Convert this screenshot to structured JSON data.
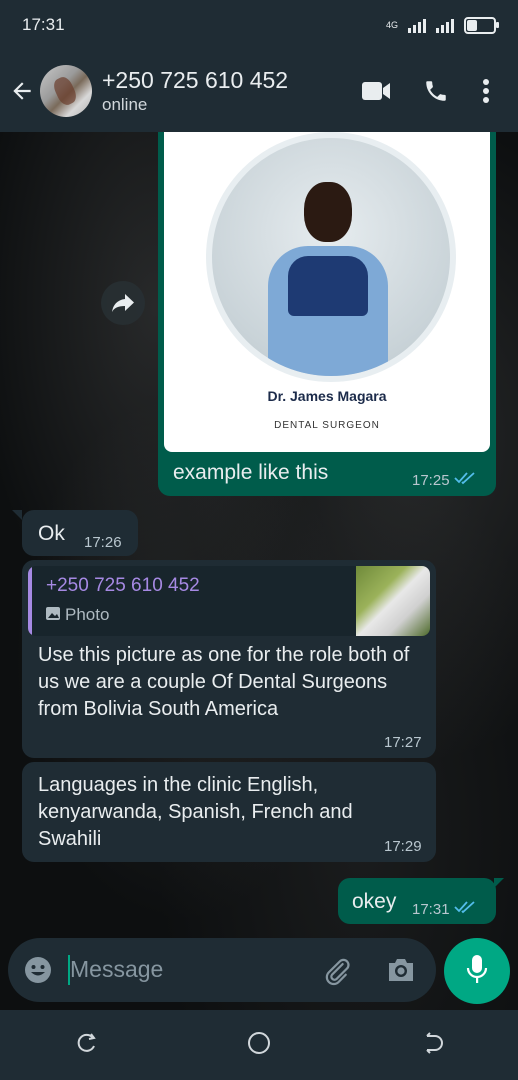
{
  "status_bar": {
    "time": "17:31",
    "network": "4G",
    "battery_level": 0.35
  },
  "header": {
    "contact_name": "+250 725 610 452",
    "contact_status": "online"
  },
  "messages": {
    "image_msg": {
      "card_name": "Dr. James Magara",
      "card_title": "DENTAL SURGEON",
      "caption": "example like this",
      "time": "17:25"
    },
    "ok_msg": {
      "text": "Ok",
      "time": "17:26"
    },
    "reply_msg": {
      "quote_sender": "+250 725 610 452",
      "quote_type": "Photo",
      "text": "Use this picture as one for the role both of us we are a couple Of Dental Surgeons from Bolivia South America",
      "time": "17:27"
    },
    "languages_msg": {
      "text": "Languages in the clinic English, kenyarwanda, Spanish, French and Swahili",
      "time": "17:29"
    },
    "okey_msg": {
      "text": "okey",
      "time": "17:31"
    }
  },
  "composer": {
    "placeholder": "Message"
  },
  "colors": {
    "accent": "#00a884",
    "outgoing_bubble": "#005c4b",
    "incoming_bubble": "#1f2c34",
    "read_ticks": "#53bdeb",
    "quote_accent": "#a689e3"
  }
}
